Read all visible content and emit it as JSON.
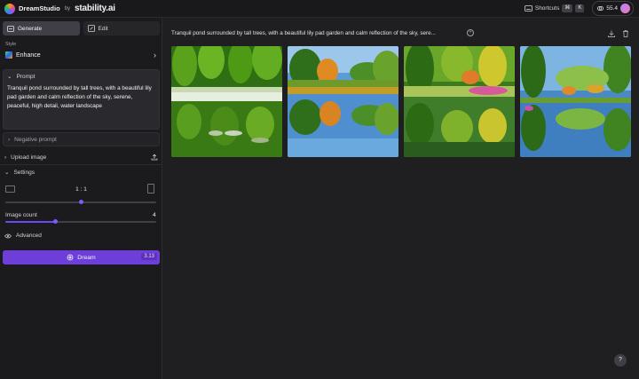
{
  "header": {
    "brand_name": "DreamStudio",
    "brand_by": "by",
    "brand_company": "stability.ai",
    "shortcuts_label": "Shortcuts",
    "shortcut_key_1": "⌘",
    "shortcut_key_2": "K",
    "credits": "55.4"
  },
  "sidebar": {
    "tabs": [
      {
        "label": "Generate",
        "active": true
      },
      {
        "label": "Edit",
        "active": false
      }
    ],
    "style_label": "Style",
    "style_value": "Enhance",
    "prompt_label": "Prompt",
    "prompt_text": "Tranquil pond surrounded by tall trees, with a beautiful lily pad garden and calm reflection of the sky, serene, peaceful, high detail, water landscape",
    "negative_prompt_label": "Negative prompt",
    "upload_image_label": "Upload image",
    "settings_label": "Settings",
    "aspect_ratio": "1 : 1",
    "aspect_slider_fraction": 0.5,
    "image_count_label": "Image count",
    "image_count": "4",
    "image_count_fraction": 0.33,
    "advanced_label": "Advanced",
    "dream_label": "Dream",
    "dream_cost": "3.13"
  },
  "main": {
    "prompt_display": "Tranquil pond surrounded by tall trees, with a beautiful lily pad garden and calm reflection of the sky, sere...",
    "help_label": "?"
  },
  "colors": {
    "accent": "#6d3fd8",
    "slider_fill": "#6d48f0",
    "background": "#1f1f22",
    "sidebar_bg": "#1b1b1e"
  }
}
